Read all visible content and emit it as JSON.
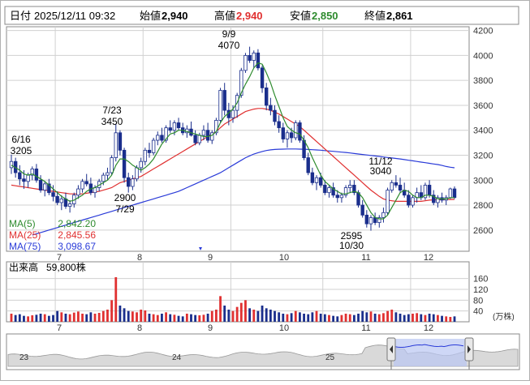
{
  "header": {
    "date_label": "日付",
    "datetime": "2025/12/11 09:32",
    "open_label": "始値",
    "open_value": "2,940",
    "high_label": "高値",
    "high_value": "2,940",
    "low_label": "安値",
    "low_value": "2,850",
    "close_label": "終値",
    "close_value": "2,861"
  },
  "colors": {
    "up_candle": "#ffffff",
    "down_candle": "#1a2e8c",
    "ma5": "#2e8b2e",
    "ma25": "#e03030",
    "ma75": "#2a3bd8",
    "high_value": "#e03030",
    "low_value": "#2e8b2e",
    "vol_up": "#e03030",
    "vol_down": "#1a2e8c",
    "grid": "#d0d0d0"
  },
  "ma_legend": [
    {
      "label": "MA(5)",
      "value": "2,842.20",
      "color": "#2e8b2e"
    },
    {
      "label": "MA(25)",
      "value": "2,845.56",
      "color": "#e03030"
    },
    {
      "label": "MA(75)",
      "value": "3,098.67",
      "color": "#2a3bd8"
    }
  ],
  "volume": {
    "label": "出来高",
    "value": "59,800株",
    "unit": "(万株)",
    "ticks": [
      "160",
      "120",
      "80",
      "40"
    ]
  },
  "navigator": {
    "labels": [
      "23",
      "24",
      "25"
    ]
  },
  "chart_data": [
    {
      "type": "candlestick",
      "title": "",
      "x_labels": [
        "7",
        "8",
        "9",
        "10",
        "11",
        "12"
      ],
      "y_ticks": [
        2600,
        2800,
        3000,
        3200,
        3400,
        3600,
        3800,
        4000,
        4200
      ],
      "ylim": [
        2430,
        4230
      ],
      "annotations": [
        {
          "date": "6/16",
          "value": "3205"
        },
        {
          "date": "7/23",
          "value": "3450"
        },
        {
          "date": "7/29",
          "value": "2900"
        },
        {
          "date": "9/9",
          "value": "4070"
        },
        {
          "date": "10/30",
          "value": "2595"
        },
        {
          "date": "11/12",
          "value": "3040"
        }
      ],
      "ohlc": [
        [
          3100,
          3205,
          3050,
          3150
        ],
        [
          3150,
          3180,
          3020,
          3060
        ],
        [
          3060,
          3120,
          2960,
          3010
        ],
        [
          3010,
          3080,
          2930,
          2990
        ],
        [
          2990,
          3060,
          2940,
          3040
        ],
        [
          3040,
          3110,
          3000,
          3090
        ],
        [
          3090,
          3130,
          2980,
          3000
        ],
        [
          3000,
          3040,
          2900,
          2920
        ],
        [
          2920,
          2990,
          2870,
          2970
        ],
        [
          2970,
          3010,
          2880,
          2900
        ],
        [
          2900,
          2960,
          2830,
          2870
        ],
        [
          2870,
          2910,
          2800,
          2820
        ],
        [
          2820,
          2880,
          2760,
          2850
        ],
        [
          2850,
          2900,
          2770,
          2790
        ],
        [
          2790,
          2840,
          2740,
          2810
        ],
        [
          2810,
          2900,
          2780,
          2880
        ],
        [
          2880,
          2960,
          2850,
          2930
        ],
        [
          2930,
          3010,
          2900,
          2990
        ],
        [
          2990,
          3050,
          2950,
          2970
        ],
        [
          2970,
          3020,
          2880,
          2900
        ],
        [
          2900,
          2960,
          2860,
          2940
        ],
        [
          2940,
          3010,
          2910,
          2990
        ],
        [
          2990,
          3060,
          2960,
          3040
        ],
        [
          3040,
          3100,
          3000,
          3060
        ],
        [
          3060,
          3200,
          3040,
          3180
        ],
        [
          3180,
          3450,
          3150,
          3380
        ],
        [
          3380,
          3400,
          3200,
          3240
        ],
        [
          3240,
          3260,
          2980,
          3020
        ],
        [
          3020,
          3060,
          2900,
          2950
        ],
        [
          2950,
          3040,
          2920,
          3010
        ],
        [
          3010,
          3120,
          2990,
          3100
        ],
        [
          3100,
          3180,
          3060,
          3150
        ],
        [
          3150,
          3260,
          3120,
          3240
        ],
        [
          3240,
          3300,
          3180,
          3220
        ],
        [
          3220,
          3340,
          3200,
          3320
        ],
        [
          3320,
          3390,
          3280,
          3360
        ],
        [
          3360,
          3420,
          3300,
          3320
        ],
        [
          3320,
          3440,
          3300,
          3420
        ],
        [
          3420,
          3480,
          3380,
          3400
        ],
        [
          3400,
          3480,
          3360,
          3460
        ],
        [
          3460,
          3500,
          3400,
          3420
        ],
        [
          3420,
          3460,
          3360,
          3380
        ],
        [
          3380,
          3440,
          3340,
          3410
        ],
        [
          3410,
          3470,
          3350,
          3360
        ],
        [
          3360,
          3400,
          3280,
          3300
        ],
        [
          3300,
          3380,
          3280,
          3360
        ],
        [
          3360,
          3440,
          3320,
          3400
        ],
        [
          3400,
          3460,
          3300,
          3320
        ],
        [
          3320,
          3400,
          3290,
          3380
        ],
        [
          3380,
          3500,
          3360,
          3480
        ],
        [
          3480,
          3740,
          3460,
          3720
        ],
        [
          3720,
          3780,
          3520,
          3560
        ],
        [
          3560,
          3620,
          3440,
          3500
        ],
        [
          3500,
          3600,
          3460,
          3560
        ],
        [
          3560,
          3700,
          3500,
          3680
        ],
        [
          3680,
          3900,
          3660,
          3880
        ],
        [
          3880,
          4020,
          3860,
          4000
        ],
        [
          4000,
          4070,
          3940,
          3960
        ],
        [
          3960,
          4040,
          3900,
          4020
        ],
        [
          4020,
          4050,
          3880,
          3900
        ],
        [
          3900,
          3920,
          3700,
          3740
        ],
        [
          3740,
          3780,
          3560,
          3600
        ],
        [
          3600,
          3660,
          3520,
          3560
        ],
        [
          3560,
          3600,
          3440,
          3470
        ],
        [
          3470,
          3520,
          3380,
          3420
        ],
        [
          3420,
          3460,
          3300,
          3330
        ],
        [
          3330,
          3400,
          3260,
          3380
        ],
        [
          3380,
          3420,
          3300,
          3340
        ],
        [
          3340,
          3480,
          3320,
          3460
        ],
        [
          3460,
          3480,
          3300,
          3320
        ],
        [
          3320,
          3360,
          3160,
          3180
        ],
        [
          3180,
          3220,
          3040,
          3060
        ],
        [
          3060,
          3100,
          2960,
          2980
        ],
        [
          2980,
          3040,
          2920,
          3020
        ],
        [
          3020,
          3060,
          2940,
          2960
        ],
        [
          2960,
          3000,
          2880,
          2900
        ],
        [
          2900,
          2960,
          2860,
          2940
        ],
        [
          2940,
          2980,
          2860,
          2880
        ],
        [
          2880,
          2920,
          2820,
          2860
        ],
        [
          2860,
          2900,
          2820,
          2880
        ],
        [
          2880,
          2960,
          2860,
          2940
        ],
        [
          2940,
          3000,
          2900,
          2960
        ],
        [
          2960,
          3000,
          2880,
          2900
        ],
        [
          2900,
          2920,
          2780,
          2800
        ],
        [
          2800,
          2840,
          2700,
          2720
        ],
        [
          2720,
          2760,
          2620,
          2650
        ],
        [
          2650,
          2720,
          2595,
          2700
        ],
        [
          2700,
          2740,
          2640,
          2660
        ],
        [
          2660,
          2720,
          2620,
          2700
        ],
        [
          2700,
          2780,
          2660,
          2740
        ],
        [
          2740,
          2940,
          2720,
          2920
        ],
        [
          2920,
          3000,
          2900,
          2980
        ],
        [
          2980,
          3040,
          2940,
          2960
        ],
        [
          2960,
          3020,
          2900,
          2920
        ],
        [
          2920,
          2980,
          2860,
          2880
        ],
        [
          2880,
          2920,
          2780,
          2800
        ],
        [
          2800,
          2880,
          2780,
          2860
        ],
        [
          2860,
          2940,
          2820,
          2900
        ],
        [
          2900,
          2960,
          2840,
          2860
        ],
        [
          2860,
          2980,
          2840,
          2960
        ],
        [
          2960,
          3000,
          2860,
          2880
        ],
        [
          2880,
          2920,
          2800,
          2820
        ],
        [
          2820,
          2880,
          2780,
          2860
        ],
        [
          2860,
          2900,
          2820,
          2840
        ],
        [
          2840,
          2880,
          2800,
          2860
        ],
        [
          2860,
          2940,
          2850,
          2930
        ],
        [
          2930,
          2950,
          2850,
          2861
        ]
      ],
      "ma5": [
        3120,
        3100,
        3080,
        3050,
        3040,
        3050,
        3030,
        3010,
        2990,
        2960,
        2930,
        2900,
        2870,
        2850,
        2830,
        2840,
        2860,
        2880,
        2910,
        2930,
        2940,
        2960,
        2980,
        3000,
        3040,
        3120,
        3170,
        3170,
        3150,
        3120,
        3100,
        3080,
        3100,
        3130,
        3170,
        3230,
        3290,
        3330,
        3370,
        3380,
        3400,
        3400,
        3390,
        3380,
        3370,
        3360,
        3350,
        3350,
        3360,
        3390,
        3460,
        3510,
        3540,
        3570,
        3620,
        3700,
        3770,
        3830,
        3900,
        3940,
        3930,
        3860,
        3780,
        3680,
        3590,
        3500,
        3430,
        3400,
        3380,
        3370,
        3320,
        3260,
        3180,
        3110,
        3040,
        2990,
        2960,
        2930,
        2910,
        2890,
        2890,
        2900,
        2910,
        2900,
        2860,
        2800,
        2740,
        2700,
        2690,
        2690,
        2720,
        2780,
        2840,
        2900,
        2920,
        2910,
        2880,
        2860,
        2860,
        2880,
        2880,
        2870,
        2850,
        2850,
        2850,
        2860,
        2860
      ],
      "ma25": [
        2960,
        2955,
        2950,
        2945,
        2940,
        2935,
        2930,
        2925,
        2920,
        2915,
        2910,
        2905,
        2900,
        2895,
        2890,
        2890,
        2890,
        2890,
        2895,
        2900,
        2905,
        2910,
        2920,
        2930,
        2940,
        2960,
        2980,
        2990,
        3000,
        3010,
        3020,
        3030,
        3050,
        3070,
        3090,
        3110,
        3130,
        3150,
        3170,
        3190,
        3210,
        3230,
        3250,
        3270,
        3290,
        3310,
        3330,
        3350,
        3370,
        3390,
        3420,
        3450,
        3470,
        3490,
        3510,
        3530,
        3550,
        3560,
        3570,
        3575,
        3575,
        3570,
        3560,
        3545,
        3530,
        3510,
        3490,
        3470,
        3450,
        3430,
        3400,
        3370,
        3340,
        3310,
        3280,
        3250,
        3220,
        3190,
        3160,
        3130,
        3100,
        3070,
        3040,
        3010,
        2980,
        2950,
        2920,
        2895,
        2870,
        2850,
        2840,
        2835,
        2830,
        2830,
        2830,
        2830,
        2830,
        2830,
        2830,
        2835,
        2840,
        2842,
        2843,
        2844,
        2845,
        2845,
        2846
      ],
      "ma75": [
        null,
        null,
        null,
        null,
        null,
        2560,
        2570,
        2580,
        2590,
        2600,
        2610,
        2620,
        2630,
        2640,
        2650,
        2660,
        2670,
        2680,
        2690,
        2700,
        2710,
        2720,
        2730,
        2740,
        2750,
        2760,
        2770,
        2780,
        2790,
        2800,
        2810,
        2820,
        2830,
        2840,
        2850,
        2860,
        2870,
        2880,
        2890,
        2900,
        2910,
        2925,
        2940,
        2955,
        2970,
        2985,
        3000,
        3015,
        3030,
        3045,
        3060,
        3080,
        3100,
        3120,
        3140,
        3160,
        3180,
        3195,
        3210,
        3220,
        3230,
        3238,
        3243,
        3246,
        3248,
        3249,
        3250,
        3250,
        3250,
        3249,
        3248,
        3246,
        3244,
        3242,
        3240,
        3237,
        3234,
        3231,
        3228,
        3225,
        3222,
        3218,
        3214,
        3210,
        3206,
        3202,
        3198,
        3194,
        3190,
        3186,
        3182,
        3178,
        3174,
        3170,
        3165,
        3160,
        3155,
        3150,
        3145,
        3140,
        3135,
        3130,
        3125,
        3118,
        3110,
        3104,
        3099
      ],
      "volume": [
        30,
        25,
        28,
        22,
        20,
        24,
        26,
        30,
        28,
        22,
        25,
        40,
        35,
        30,
        28,
        34,
        38,
        30,
        28,
        35,
        30,
        33,
        40,
        45,
        80,
        165,
        60,
        50,
        40,
        38,
        35,
        45,
        42,
        30,
        28,
        25,
        30,
        35,
        28,
        26,
        22,
        20,
        30,
        28,
        25,
        24,
        26,
        30,
        40,
        45,
        95,
        60,
        45,
        40,
        55,
        70,
        80,
        50,
        45,
        40,
        60,
        50,
        45,
        40,
        35,
        30,
        28,
        32,
        40,
        35,
        30,
        28,
        35,
        40,
        30,
        28,
        25,
        22,
        20,
        25,
        30,
        28,
        25,
        30,
        40,
        35,
        38,
        30,
        28,
        32,
        40,
        45,
        35,
        30,
        25,
        28,
        30,
        32,
        28,
        25,
        30,
        28,
        25,
        22,
        20,
        18,
        20
      ],
      "volume_ticks": [
        40,
        80,
        120,
        160
      ]
    }
  ]
}
